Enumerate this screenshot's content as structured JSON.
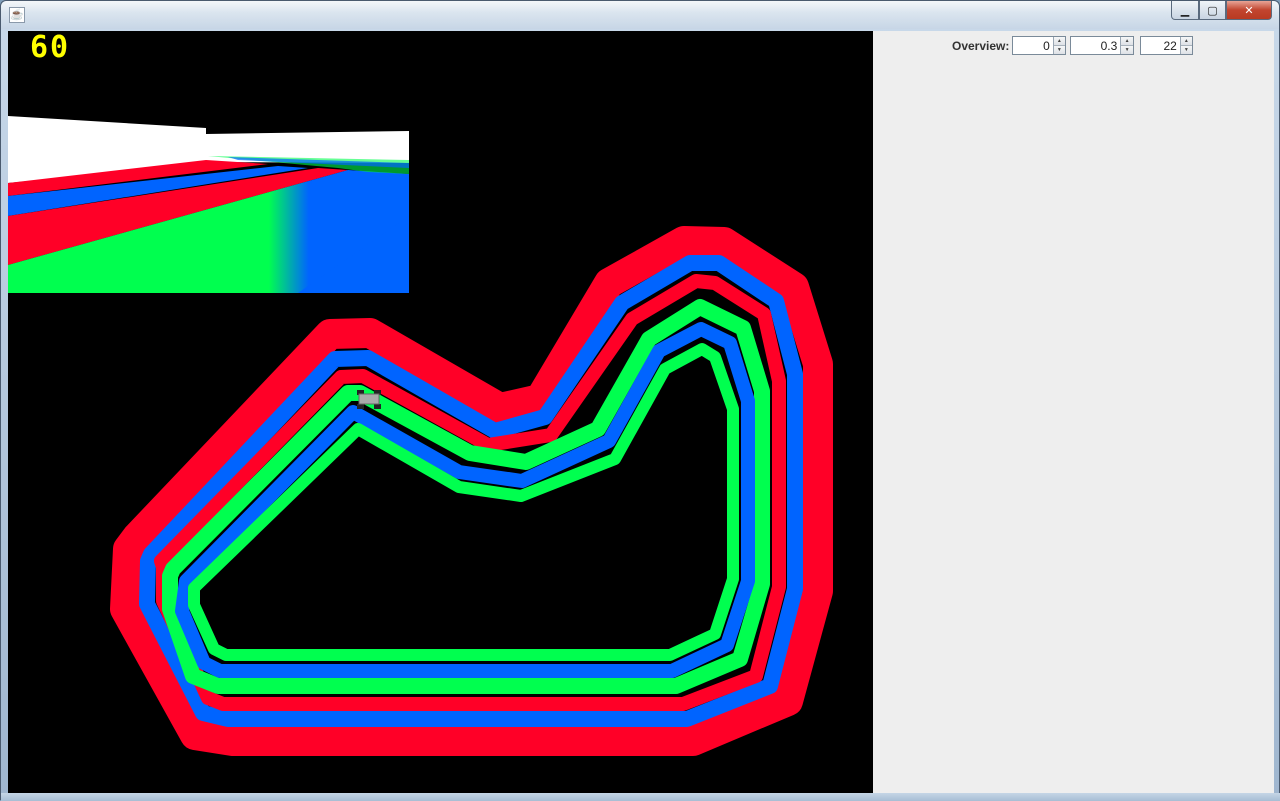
{
  "window": {
    "title": "",
    "buttons": {
      "minimize": "▁",
      "maximize": "▢",
      "close": "✕"
    }
  },
  "game": {
    "fps": "60",
    "colors": {
      "red": "#ff0027",
      "blue": "#0064ff",
      "green": "#00ff4f",
      "sky": "#ffffff",
      "background": "#000000"
    },
    "icons": {
      "car": "car-icon"
    }
  },
  "panel": {
    "overview_label": "Overview:",
    "spinners": [
      {
        "value": "0"
      },
      {
        "value": "0.3"
      },
      {
        "value": "22"
      }
    ]
  }
}
